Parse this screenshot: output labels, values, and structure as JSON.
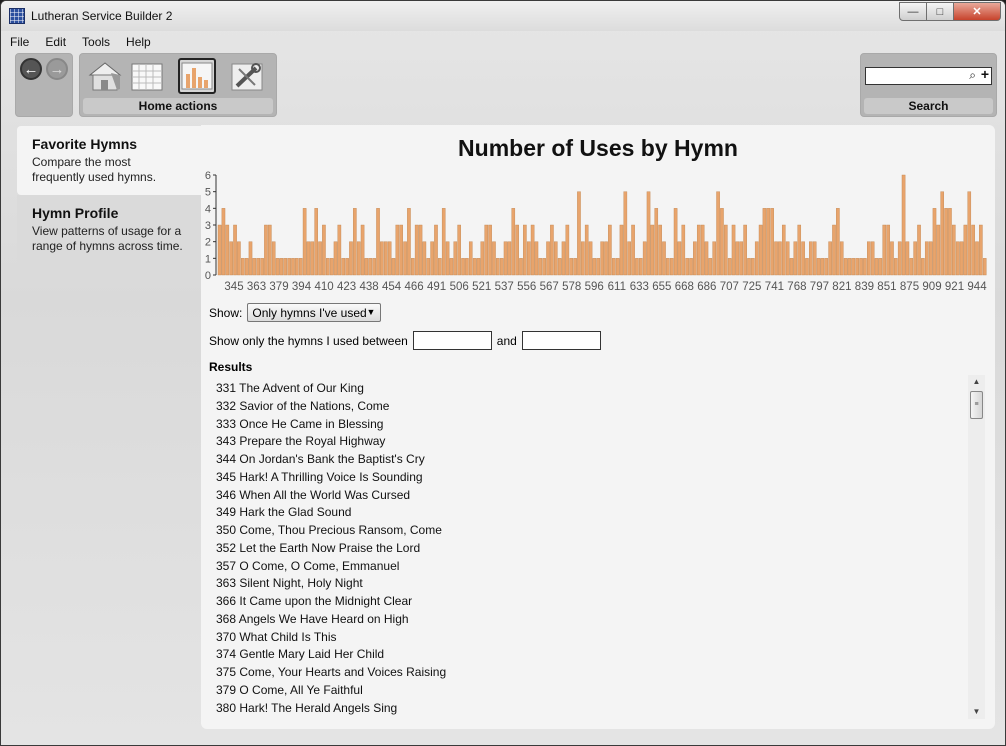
{
  "window": {
    "title": "Lutheran Service Builder 2",
    "min": "—",
    "max": "□",
    "close": "✕"
  },
  "menu": [
    "File",
    "Edit",
    "Tools",
    "Help"
  ],
  "toolbar": {
    "back_icon": "←",
    "forward_icon": "→",
    "home_label": "Home actions",
    "search_label": "Search",
    "search_value": "",
    "search_icon": "⌕",
    "add_icon": "+"
  },
  "sidebar": {
    "items": [
      {
        "title": "Favorite Hymns",
        "desc": "Compare the most frequently used hymns."
      },
      {
        "title": "Hymn Profile",
        "desc": "View patterns of usage for a range of hymns across time."
      }
    ]
  },
  "colors": {
    "bar": "#e8a46c",
    "bar_border": "#c08550",
    "accent": "#2c4f9e"
  },
  "chart_data": {
    "type": "bar",
    "title": "Number of Uses by Hymn",
    "ylim": [
      0,
      6
    ],
    "yticks": [
      "0",
      "1",
      "2",
      "3",
      "4",
      "5",
      "6"
    ],
    "xtick_labels": [
      "345",
      "363",
      "379",
      "394",
      "410",
      "423",
      "438",
      "454",
      "466",
      "491",
      "506",
      "521",
      "537",
      "556",
      "567",
      "578",
      "596",
      "611",
      "633",
      "655",
      "668",
      "686",
      "707",
      "725",
      "741",
      "768",
      "797",
      "821",
      "839",
      "851",
      "875",
      "909",
      "921",
      "944"
    ],
    "values": [
      3,
      4,
      3,
      2,
      3,
      2,
      1,
      1,
      2,
      1,
      1,
      1,
      3,
      3,
      2,
      1,
      1,
      1,
      1,
      1,
      1,
      1,
      4,
      2,
      2,
      4,
      2,
      3,
      1,
      1,
      2,
      3,
      1,
      1,
      2,
      4,
      2,
      3,
      1,
      1,
      1,
      4,
      2,
      2,
      2,
      1,
      3,
      3,
      2,
      4,
      1,
      3,
      3,
      2,
      1,
      2,
      3,
      1,
      4,
      2,
      1,
      2,
      3,
      1,
      1,
      2,
      1,
      1,
      2,
      3,
      3,
      2,
      1,
      1,
      2,
      2,
      4,
      3,
      1,
      3,
      2,
      3,
      2,
      1,
      1,
      2,
      3,
      2,
      1,
      2,
      3,
      1,
      1,
      5,
      2,
      3,
      2,
      1,
      1,
      2,
      2,
      3,
      1,
      1,
      3,
      5,
      2,
      3,
      1,
      1,
      2,
      5,
      3,
      4,
      3,
      2,
      1,
      1,
      4,
      2,
      3,
      1,
      1,
      2,
      3,
      3,
      2,
      1,
      2,
      5,
      4,
      3,
      1,
      3,
      2,
      2,
      3,
      1,
      1,
      2,
      3,
      4,
      4,
      4,
      2,
      2,
      3,
      2,
      1,
      2,
      3,
      2,
      1,
      2,
      2,
      1,
      1,
      1,
      2,
      3,
      4,
      2,
      1,
      1,
      1,
      1,
      1,
      1,
      2,
      2,
      1,
      1,
      3,
      3,
      2,
      1,
      2,
      6,
      2,
      1,
      2,
      3,
      1,
      2,
      2,
      4,
      3,
      5,
      4,
      4,
      3,
      2,
      2,
      3,
      5,
      3,
      2,
      3,
      1
    ],
    "grid": false
  },
  "filters": {
    "show_label": "Show:",
    "show_value": "Only hymns I've used",
    "range_label": "Show only the hymns I used between",
    "and_label": "and",
    "range_from": "",
    "range_to": ""
  },
  "results": {
    "label": "Results",
    "items": [
      "331 The Advent of Our King",
      "332 Savior of the Nations, Come",
      "333 Once He Came in Blessing",
      "343 Prepare the Royal Highway",
      "344 On Jordan's Bank the Baptist's Cry",
      "345 Hark! A Thrilling Voice Is Sounding",
      "346 When All the World Was Cursed",
      "349 Hark the Glad Sound",
      "350 Come, Thou Precious Ransom, Come",
      "352 Let the Earth Now Praise the Lord",
      "357 O Come, O Come, Emmanuel",
      "363 Silent Night, Holy Night",
      "366 It Came upon the Midnight Clear",
      "368 Angels We Have Heard on High",
      "370 What Child Is This",
      "374 Gentle Mary Laid Her Child",
      "375 Come, Your Hearts and Voices Raising",
      "379 O Come, All Ye Faithful",
      "380 Hark! The Herald Angels Sing"
    ]
  },
  "scrollbar": {
    "up": "▲",
    "down": "▼",
    "grip": "≡"
  }
}
